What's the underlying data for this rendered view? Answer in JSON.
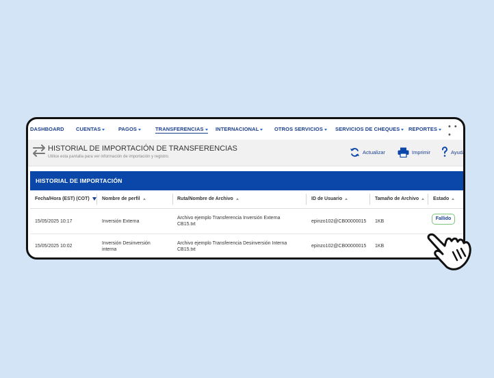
{
  "nav": {
    "items": [
      "DASHBOARD",
      "CUENTAS",
      "PAGOS",
      "TRANSFERENCIAS",
      "INTERNACIONAL",
      "OTROS SERVICIOS",
      "SERVICIOS DE CHEQUES",
      "REPORTES"
    ],
    "more": "• • •"
  },
  "page": {
    "title": "HISTORIAL DE IMPORTACIÓN DE TRANSFERENCIAS",
    "subtitle": "Utilice esta pantalla para ver información de importación y registro."
  },
  "toolbar": {
    "refresh_label": "Actualizar",
    "print_label": "Imprimir",
    "help_label": "Ayuda"
  },
  "section": {
    "title": "HISTORIAL DE IMPORTACIÓN"
  },
  "table": {
    "columns": [
      "Fecha/Hora (EST) (COT)",
      "Nombre de perfil",
      "Ruta/Nombre de Archivo",
      "ID de Usuario",
      "Tamaño de Archivo",
      "Estado"
    ],
    "rows": [
      {
        "datetime": "15/05/2025 10:17",
        "profile": "Inversión Externa",
        "file_line1": "Archivo ejemplo Transferencia Inversión Externa",
        "file_line2": "CB15.txt",
        "user_id": "epinzo102@CB00000015",
        "size": "1KB",
        "status": "Fallido"
      },
      {
        "datetime": "15/05/2025 10:02",
        "profile_line1": "Inversión Desinversión",
        "profile_line2": "interna",
        "file_line1": "Archivo ejemplo Transferencia Desinversión Interna",
        "file_line2": "CB15.txt",
        "user_id": "epinzo102@CB00000015",
        "size": "1KB"
      }
    ]
  },
  "colors": {
    "primary": "#0a47a8",
    "nav_text": "#1a3f8f",
    "status_border": "#7cc47a",
    "background": "#d3e4f6"
  },
  "icons": [
    "swap-arrows-icon",
    "refresh-icon",
    "printer-icon",
    "help-icon",
    "pointer-hand-icon"
  ]
}
